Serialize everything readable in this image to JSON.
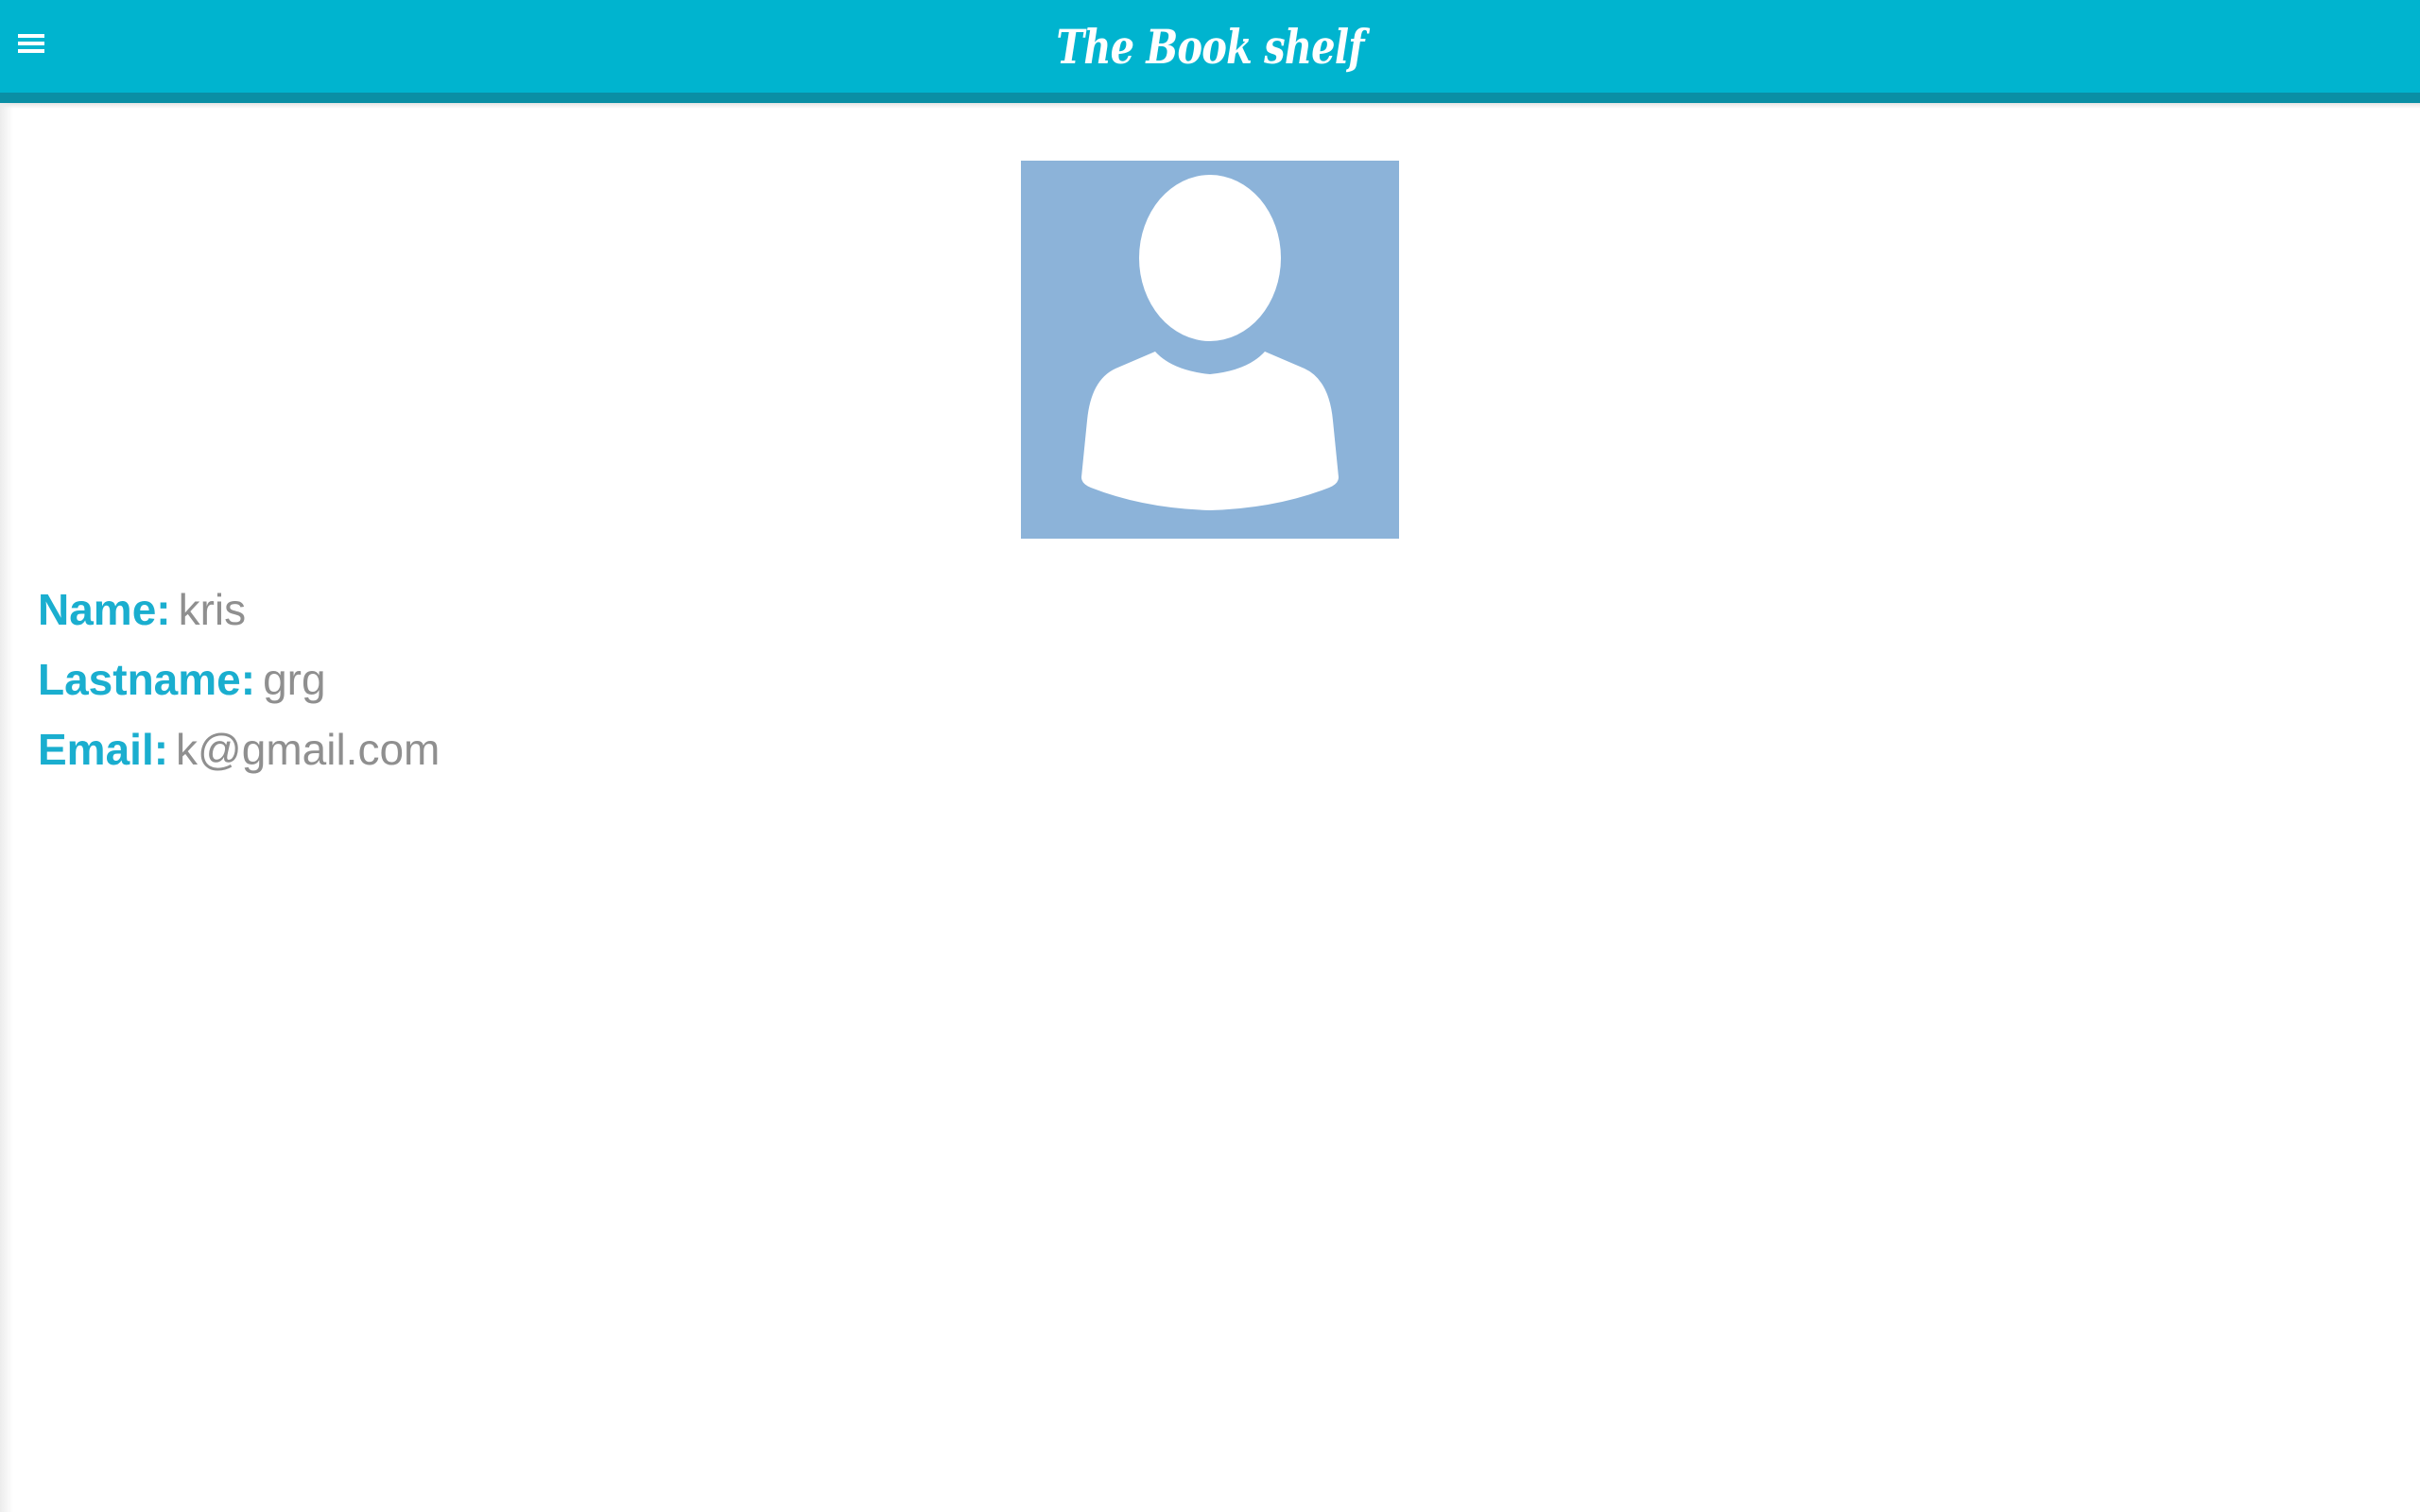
{
  "header": {
    "title": "The Book shelf",
    "menu_icon": "hamburger-menu-icon",
    "background_color": "#00b4cf",
    "border_color": "#0a8fa5"
  },
  "profile": {
    "avatar_icon": "user-silhouette-icon",
    "avatar_background": "#8cb3d9",
    "fields": [
      {
        "label": "Name:",
        "value": "kris"
      },
      {
        "label": "Lastname:",
        "value": "grg"
      },
      {
        "label": "Email:",
        "value": "k@gmail.com"
      }
    ],
    "label_color": "#1aaecf",
    "value_color": "#8f8f8f"
  }
}
